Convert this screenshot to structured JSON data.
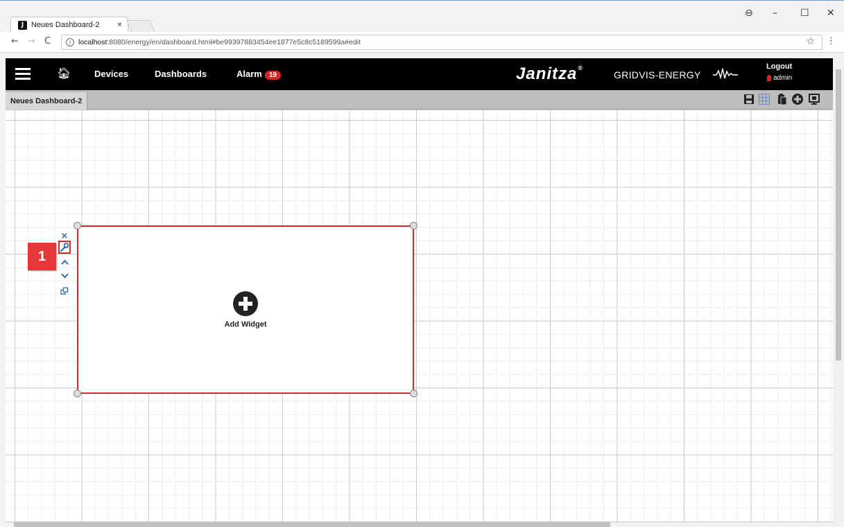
{
  "browser": {
    "tab_title": "Neues Dashboard-2",
    "tab_favicon": "J",
    "tab_close": "×",
    "url_host": "localhost",
    "url_rest": ":8080/energy/en/dashboard.html#be99397883454ee1877e5c8c5189599a#edit",
    "window_controls": {
      "profile": "⊖",
      "minimize": "–",
      "maximize": "☐",
      "close": "✕"
    }
  },
  "header": {
    "nav_devices": "Devices",
    "nav_dashboards": "Dashboards",
    "nav_alarm": "Alarm",
    "alarm_count": "19",
    "brand": "Janitza",
    "registered": "®",
    "product": "GRIDVIS-ENERGY",
    "logout": "Logout",
    "user": "admin"
  },
  "dashboard": {
    "tab_label": "Neues Dashboard-2",
    "tools": [
      "save-icon",
      "grid-icon",
      "paste-icon",
      "add-circle-icon",
      "present-icon"
    ]
  },
  "widget": {
    "add_label": "Add Widget",
    "tools": {
      "close": "×",
      "up": "^",
      "down": "v",
      "copy": "⎘"
    }
  },
  "annotation": {
    "step": "1"
  },
  "colors": {
    "accent_red": "#d22b2b",
    "header_bg": "#000000",
    "tool_blue": "#2a6aa8"
  }
}
